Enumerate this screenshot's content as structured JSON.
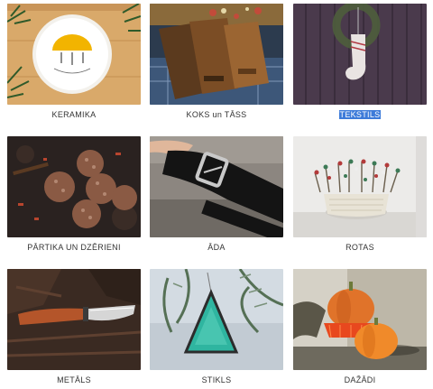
{
  "categories": [
    {
      "label": "KERAMIKA",
      "selected": false
    },
    {
      "label": "KOKS un TĀSS",
      "selected": false
    },
    {
      "label": "TEKSTILS",
      "selected": true
    },
    {
      "label": "PĀRTIKA UN DZĒRIENI",
      "selected": false
    },
    {
      "label": "ĀDA",
      "selected": false
    },
    {
      "label": "ROTAS",
      "selected": false
    },
    {
      "label": "METĀLS",
      "selected": false
    },
    {
      "label": "STIKLS",
      "selected": false
    },
    {
      "label": "DAŽĀDI",
      "selected": false
    }
  ],
  "colors": {
    "selection_highlight": "#3d7bd9",
    "label_text": "#333333"
  }
}
